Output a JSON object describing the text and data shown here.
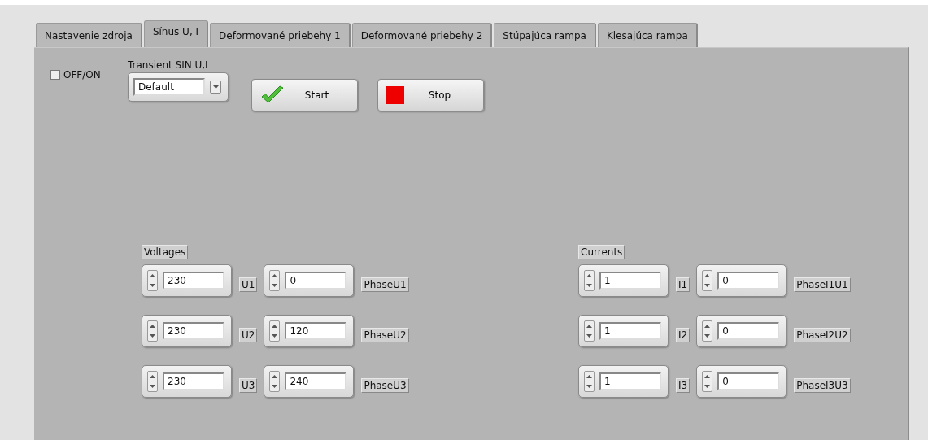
{
  "tabs": [
    {
      "label": "Nastavenie zdroja",
      "selected": false
    },
    {
      "label": "Sínus U, I",
      "selected": true
    },
    {
      "label": "Deformované priebehy 1",
      "selected": false
    },
    {
      "label": "Deformované priebehy 2",
      "selected": false
    },
    {
      "label": "Stúpajúca rampa",
      "selected": false
    },
    {
      "label": "Klesajúca rampa",
      "selected": false
    }
  ],
  "power_switch": {
    "label": "OFF/ON",
    "checked": false
  },
  "transient_select": {
    "label": "Transient SIN U,I",
    "value": "Default"
  },
  "buttons": [
    {
      "kind": "start",
      "label": "Start"
    },
    {
      "kind": "stop",
      "label": "Stop"
    }
  ],
  "groups": [
    {
      "title": "Voltages",
      "rows": [
        {
          "value": "230",
          "label": "U1",
          "phase_value": "0",
          "phase_label": "PhaseU1"
        },
        {
          "value": "230",
          "label": "U2",
          "phase_value": "120",
          "phase_label": "PhaseU2"
        },
        {
          "value": "230",
          "label": "U3",
          "phase_value": "240",
          "phase_label": "PhaseU3"
        }
      ]
    },
    {
      "title": "Currents",
      "rows": [
        {
          "value": "1",
          "label": "I1",
          "phase_value": "0",
          "phase_label": "PhaseI1U1"
        },
        {
          "value": "1",
          "label": "I2",
          "phase_value": "0",
          "phase_label": "PhaseI2U2"
        },
        {
          "value": "1",
          "label": "I3",
          "phase_value": "0",
          "phase_label": "PhaseI3U3"
        }
      ]
    }
  ]
}
